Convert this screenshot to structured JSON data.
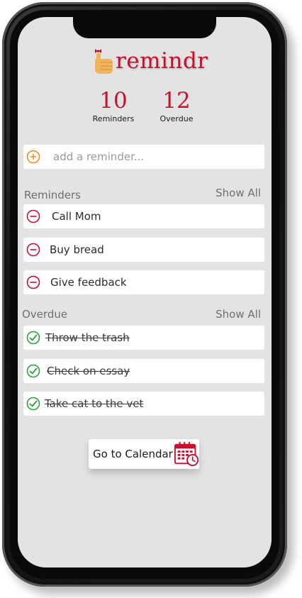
{
  "app": {
    "name": "remindr",
    "logo_icon": "hand-with-bow-icon"
  },
  "stats": {
    "reminders_count": "10",
    "reminders_label": "Reminders",
    "overdue_count": "12",
    "overdue_label": "Overdue"
  },
  "add_input": {
    "placeholder": "add a reminder...",
    "icon": "plus-circle-icon"
  },
  "reminders": {
    "title": "Reminders",
    "show_all": "Show All",
    "items": [
      {
        "label": "Call Mom",
        "icon": "minus-circle-icon"
      },
      {
        "label": "Buy bread",
        "icon": "minus-circle-icon"
      },
      {
        "label": "Give feedback",
        "icon": "minus-circle-icon"
      }
    ]
  },
  "overdue": {
    "title": "Overdue",
    "show_all": "Show All",
    "items": [
      {
        "label": "Throw the trash",
        "icon": "check-circle-icon"
      },
      {
        "label": "Check on essay",
        "icon": "check-circle-icon"
      },
      {
        "label": "Take cat to the vet",
        "icon": "check-circle-icon"
      }
    ]
  },
  "calendar_button": {
    "label": "Go to Calendar",
    "icon": "calendar-clock-icon"
  },
  "colors": {
    "accent_red": "#c8102e",
    "add_orange": "#f08a24",
    "check_green": "#2e9e3f",
    "screen_bg": "#e3e3e3"
  }
}
